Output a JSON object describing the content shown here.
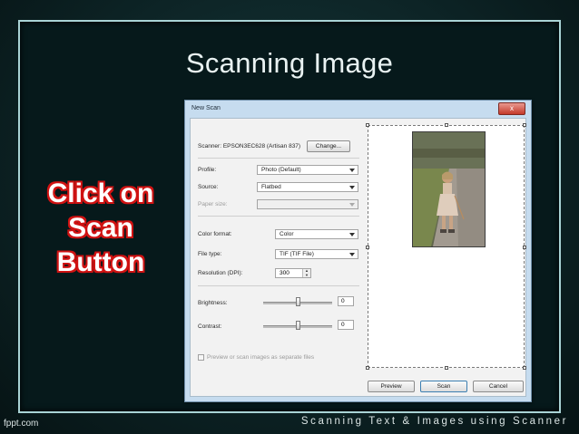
{
  "slide": {
    "title": "Scanning Image",
    "callout_lines": [
      "Click on",
      "Scan",
      "Button"
    ],
    "footer_left": "fppt.com",
    "footer_right": "Scanning Text & Images using Scanner"
  },
  "dialog": {
    "title": "New Scan",
    "close_label": "x",
    "scanner_label": "Scanner: EPSON3EC628 (Artisan 837)",
    "change_button": "Change...",
    "fields": {
      "profile": {
        "label": "Profile:",
        "value": "Photo (Default)"
      },
      "source": {
        "label": "Source:",
        "value": "Flatbed"
      },
      "paper_size": {
        "label": "Paper size:",
        "value": ""
      },
      "color_format": {
        "label": "Color format:",
        "value": "Color"
      },
      "file_type": {
        "label": "File type:",
        "value": "TIF (TIF File)"
      },
      "resolution": {
        "label": "Resolution (DPI):",
        "value": "300"
      },
      "brightness": {
        "label": "Brightness:",
        "value": "0",
        "level": 0.5
      },
      "contrast": {
        "label": "Contrast:",
        "value": "0",
        "level": 0.5
      }
    },
    "checkbox_label": "Preview or scan images as separate files",
    "buttons": {
      "preview": "Preview",
      "scan": "Scan",
      "cancel": "Cancel"
    }
  }
}
